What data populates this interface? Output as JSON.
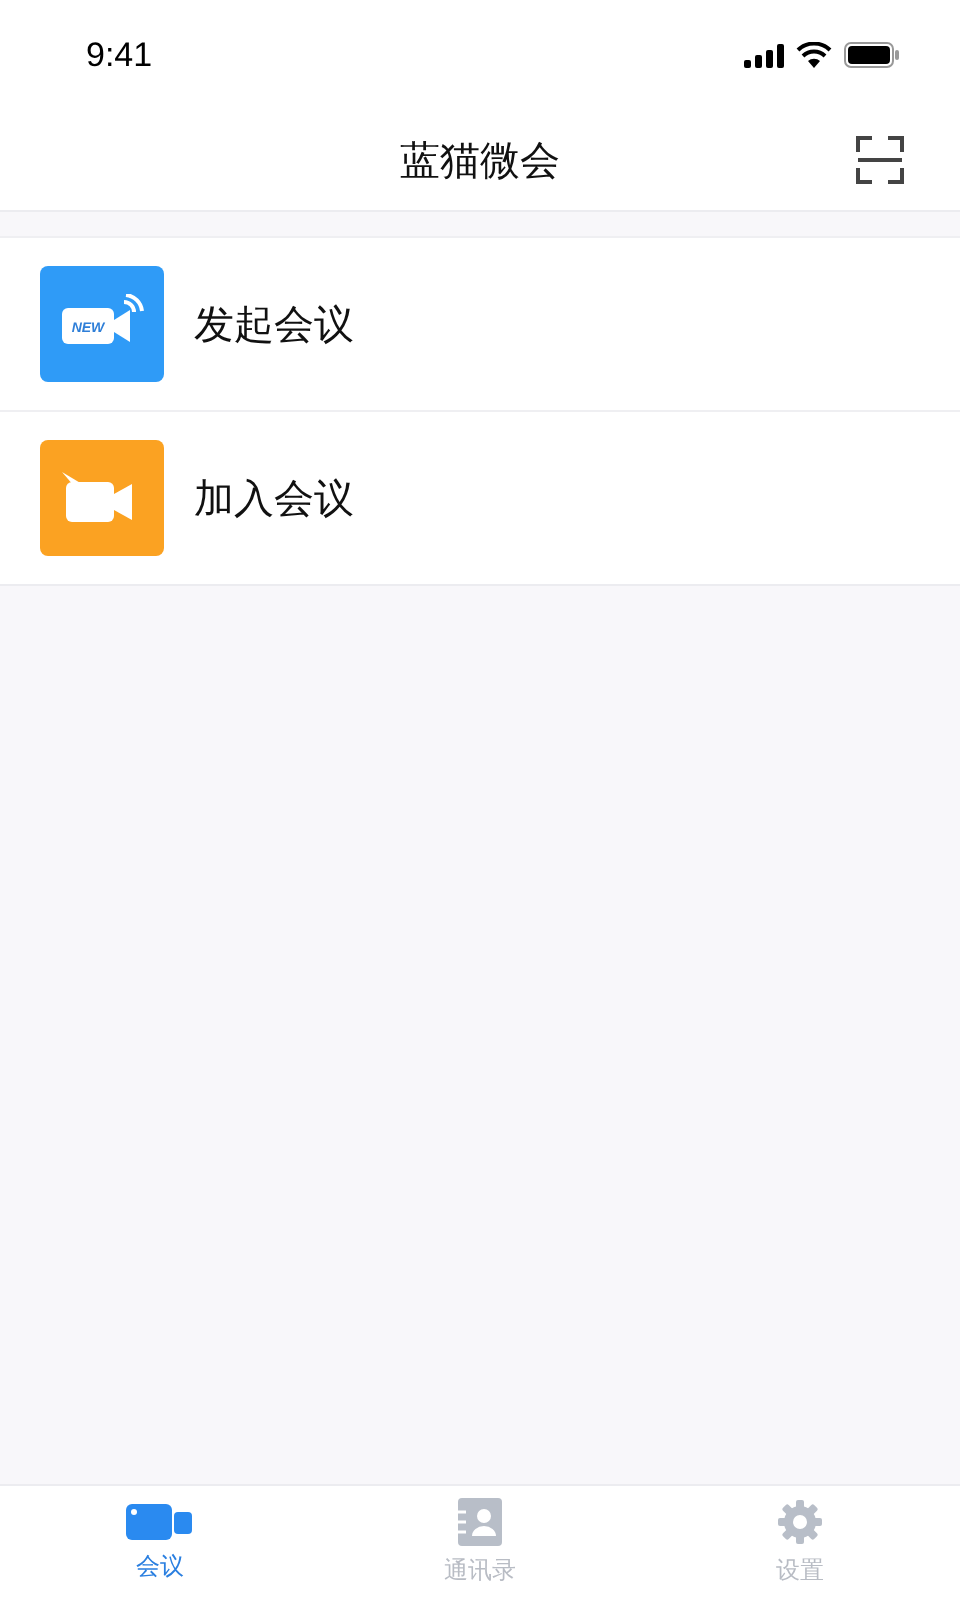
{
  "status_bar": {
    "time": "9:41"
  },
  "nav_bar": {
    "title": "蓝猫微会"
  },
  "menu": [
    {
      "kind": "start",
      "label": "发起会议",
      "icon_text": "NEW",
      "color": "#2f9bf7"
    },
    {
      "kind": "join",
      "label": "加入会议",
      "color": "#fba222"
    }
  ],
  "tab_bar": [
    {
      "kind": "meeting",
      "label": "会议",
      "selected": true
    },
    {
      "kind": "contacts",
      "label": "通讯录",
      "selected": false
    },
    {
      "kind": "settings",
      "label": "设置",
      "selected": false
    }
  ]
}
